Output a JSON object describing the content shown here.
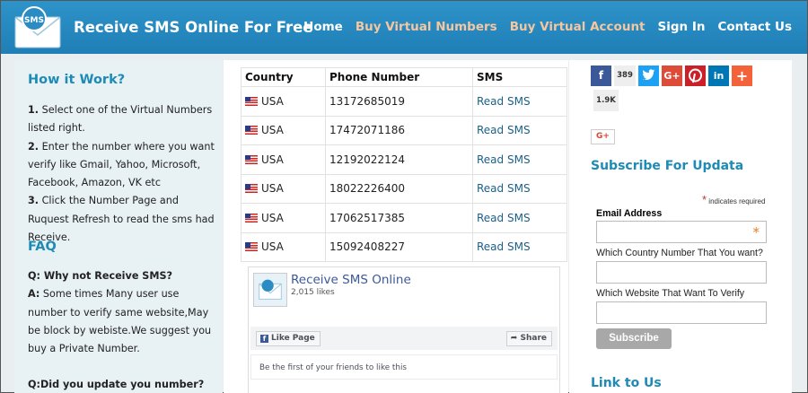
{
  "header": {
    "title": "Receive SMS Online For Free",
    "logo_text": "SMS",
    "nav": [
      {
        "label": "Home"
      },
      {
        "label": "Buy Virtual Numbers"
      },
      {
        "label": "Buy Virtual Account"
      },
      {
        "label": "Sign In"
      },
      {
        "label": "Contact Us"
      }
    ]
  },
  "left": {
    "how_title": "How it Work?",
    "step1_num": "1.",
    "step1": " Select one of the Virtual Numbers listed right.",
    "step2_num": "2.",
    "step2": " Enter the number where you want verify like Gmail, Yahoo, Microsoft, Facebook, Amazon, VK etc",
    "step3_num": "3.",
    "step3": " Click the Number Page and Ruquest Refresh to read the sms had Receive.",
    "faq_title": "FAQ",
    "q1": "Q: Why not Receive SMS?",
    "a1_label": "A:",
    "a1": " Some times Many user use number to verify same website,May be block by webiste.We suggest you buy a Private Number.",
    "q2": "Q:Did you update you number?"
  },
  "table": {
    "headers": [
      "Country",
      "Phone Number",
      "SMS"
    ],
    "rows": [
      {
        "country": "USA",
        "number": "13172685019",
        "sms": "Read SMS"
      },
      {
        "country": "USA",
        "number": "17472071186",
        "sms": "Read SMS"
      },
      {
        "country": "USA",
        "number": "12192022124",
        "sms": "Read SMS"
      },
      {
        "country": "USA",
        "number": "18022226400",
        "sms": "Read SMS"
      },
      {
        "country": "USA",
        "number": "17062517385",
        "sms": "Read SMS"
      },
      {
        "country": "USA",
        "number": "15092408227",
        "sms": "Read SMS"
      }
    ]
  },
  "facebook": {
    "page_name": "Receive SMS Online",
    "likes": "2,015 likes",
    "like_label": "Like Page",
    "share_label": "Share",
    "first_text": "Be the first of your friends to like this"
  },
  "share": {
    "fb_count": "389",
    "total_count": "1.9K",
    "gplus_label": "G+",
    "colors": {
      "facebook": "#3b5998",
      "twitter": "#1da1f2",
      "gplus": "#dd4b39",
      "pinterest": "#cb2027",
      "linkedin": "#0077b5",
      "more": "#f4623a"
    }
  },
  "subscribe": {
    "title": "Subscribe For Updata",
    "required_note": "indicates required",
    "email_label": "Email Address",
    "country_label": "Which Country Number That You want?",
    "website_label": "Which Website That Want To Verify",
    "button": "Subscribe",
    "link_title": "Link to Us"
  }
}
